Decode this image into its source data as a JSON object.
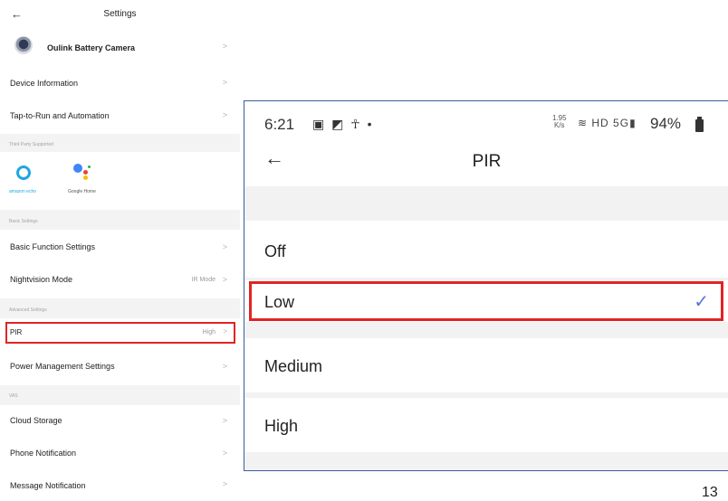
{
  "left": {
    "back_icon": "←",
    "title": "Settings",
    "camera_name": "Oulink Battery Camera",
    "chevron": ">",
    "rows": {
      "device_info": "Device Information",
      "tap_to_run": "Tap-to-Run and Automation",
      "third_party_header": "Third Party Supported",
      "alexa_label": "amazon echo",
      "google_label": "Google Home",
      "basic_header": "Basic Settings",
      "basic_function": "Basic Function Settings",
      "nightvision": "Nightvision Mode",
      "nightvision_value": "IR Mode",
      "advanced_header": "Advanced Settings",
      "pir": "PIR",
      "pir_value": "High",
      "power": "Power Management Settings",
      "vas_header": "VAS",
      "cloud": "Cloud Storage",
      "phone_notif": "Phone Notification",
      "message_notif": "Message Notification"
    },
    "colors": {
      "highlight": "#e02424",
      "alexa": "#1fa7e0"
    }
  },
  "right": {
    "status": {
      "time": "6:21",
      "left_icons": "▣ ◩ ☥ •",
      "speed_top": "1.95",
      "speed_bottom": "K/s",
      "net_icons": "≋ HD 5G▮",
      "battery": "94%"
    },
    "back_icon": "←",
    "title": "PIR",
    "options": [
      "Off",
      "Low",
      "Medium",
      "High"
    ],
    "selected": "Low",
    "check": "✓",
    "colors": {
      "check": "#5a77d6",
      "highlight": "#e02424"
    }
  },
  "page_number": "13"
}
